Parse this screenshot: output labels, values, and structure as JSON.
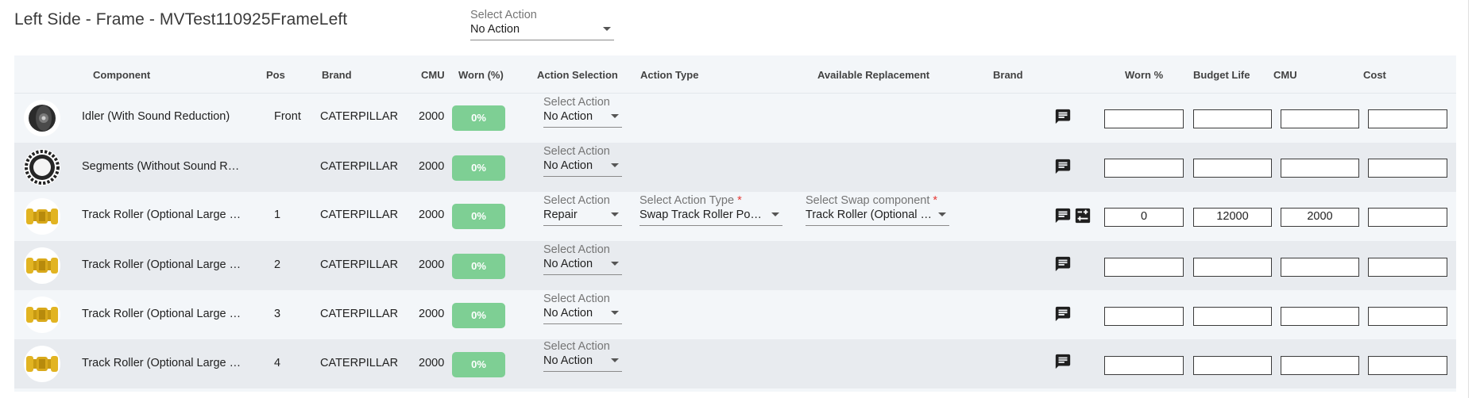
{
  "page": {
    "title": "Left Side - Frame - MVTest110925FrameLeft",
    "top_action": {
      "label": "Select Action",
      "value": "No Action"
    }
  },
  "table": {
    "headers": {
      "component": "Component",
      "pos": "Pos",
      "brand": "Brand",
      "cmu": "CMU",
      "worn": "Worn (%)",
      "action_selection": "Action Selection",
      "action_type": "Action Type",
      "available_replacement": "Available Replacement",
      "brand2": "Brand",
      "worn_pct": "Worn %",
      "budget_life": "Budget Life",
      "cmu2": "CMU",
      "cost": "Cost"
    },
    "rows": [
      {
        "image": "idler",
        "name": "Idler (With Sound Reduction)",
        "pos": "Front",
        "brand": "CATERPILLAR",
        "cmu": "2000",
        "worn": "0%",
        "action": {
          "label": "Select Action",
          "value": "No Action"
        },
        "inputs": {
          "worn_pct": "",
          "budget_life": "",
          "cmu": "",
          "cost": ""
        }
      },
      {
        "image": "segments",
        "name": "Segments (Without Sound Red...",
        "pos": "",
        "brand": "CATERPILLAR",
        "cmu": "2000",
        "worn": "0%",
        "action": {
          "label": "Select Action",
          "value": "No Action"
        },
        "inputs": {
          "worn_pct": "",
          "budget_life": "",
          "cmu": "",
          "cost": ""
        }
      },
      {
        "image": "track-roller",
        "name": "Track Roller (Optional Large Di...",
        "pos": "1",
        "brand": "CATERPILLAR",
        "cmu": "2000",
        "worn": "0%",
        "action": {
          "label": "Select Action",
          "value": "Repair"
        },
        "action_type": {
          "label": "Select Action Type",
          "required": "*",
          "value": "Swap Track Roller Positi..."
        },
        "swap": {
          "label": "Select Swap component",
          "required": "*",
          "value": "Track Roller (Optional La..."
        },
        "inputs": {
          "worn_pct": "0",
          "budget_life": "12000",
          "cmu": "2000",
          "cost": ""
        }
      },
      {
        "image": "track-roller",
        "name": "Track Roller (Optional Large Di...",
        "pos": "2",
        "brand": "CATERPILLAR",
        "cmu": "2000",
        "worn": "0%",
        "action": {
          "label": "Select Action",
          "value": "No Action"
        },
        "inputs": {
          "worn_pct": "",
          "budget_life": "",
          "cmu": "",
          "cost": ""
        }
      },
      {
        "image": "track-roller",
        "name": "Track Roller (Optional Large Di...",
        "pos": "3",
        "brand": "CATERPILLAR",
        "cmu": "2000",
        "worn": "0%",
        "action": {
          "label": "Select Action",
          "value": "No Action"
        },
        "inputs": {
          "worn_pct": "",
          "budget_life": "",
          "cmu": "",
          "cost": ""
        }
      },
      {
        "image": "track-roller",
        "name": "Track Roller (Optional Large Di...",
        "pos": "4",
        "brand": "CATERPILLAR",
        "cmu": "2000",
        "worn": "0%",
        "action": {
          "label": "Select Action",
          "value": "No Action"
        },
        "inputs": {
          "worn_pct": "",
          "budget_life": "",
          "cmu": "",
          "cost": ""
        }
      }
    ]
  },
  "icons": {
    "comment": "comment-icon",
    "tune": "tune-icon"
  },
  "colors": {
    "worn_badge": "#7ecf94",
    "required": "#e53935",
    "row_alt": "#e8ebef",
    "row": "#f3f6f9"
  }
}
